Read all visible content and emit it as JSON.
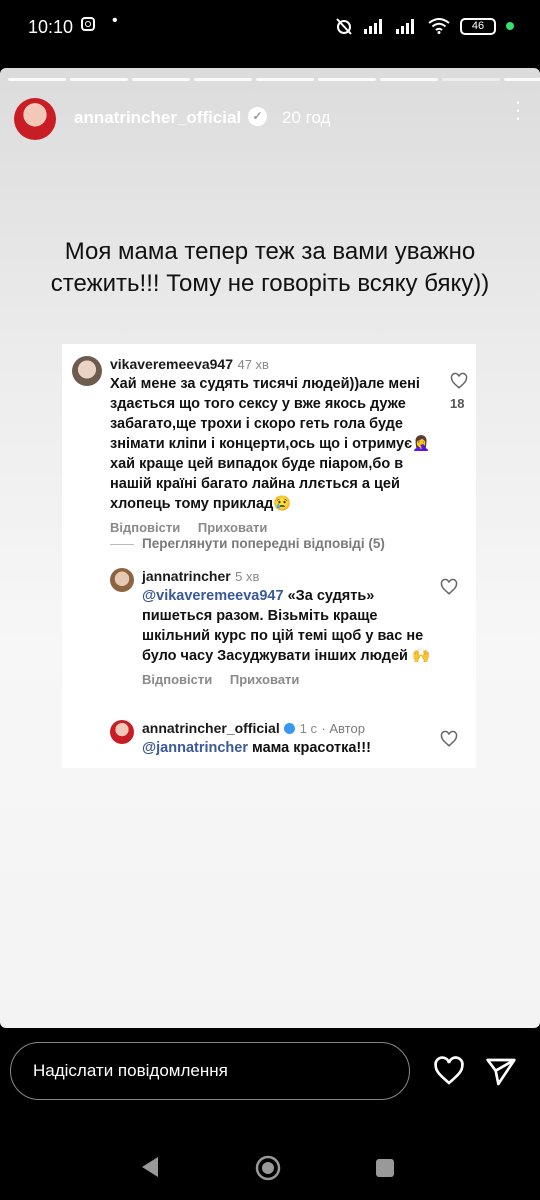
{
  "status_bar": {
    "time": "10:10",
    "battery": "46"
  },
  "story": {
    "username": "annatrincher_official",
    "age": "20 год",
    "caption": "Моя мама тепер теж за вами уважно стежить!!! Тому не говоріть всяку бяку))"
  },
  "comments": [
    {
      "user": "vikaveremeeva947",
      "time": "47 хв",
      "text": "Хай мене за судять тисячі людей))але мені здається що того сексу у вже якось дуже забагато,ще трохи і скоро геть гола буде знімати кліпи і концерти,ось що і отримує🤦‍♀️ хай краще цей випадок буде піаром,бо в нашій країні багато лайна ллється а цей хлопець тому приклад😢",
      "likes": "18",
      "reply_label": "Відповісти",
      "hide_label": "Приховати"
    },
    {
      "view_previous": "Переглянути попередні відповіді (5)"
    },
    {
      "user": "jannatrincher",
      "time": "5 хв",
      "mention": "@vikaveremeeva947",
      "text": " «За судять» пишеться разом. Візьміть краще шкільний курс по цій темі щоб у вас не було часу Засуджувати інших людей 🙌",
      "reply_label": "Відповісти",
      "hide_label": "Приховати"
    },
    {
      "user": "annatrincher_official",
      "time": "1 с",
      "author_label": "Автор",
      "mention": "@jannatrincher",
      "text": " мама красотка!!!"
    }
  ],
  "message_input": {
    "placeholder": "Надіслати повідомлення"
  },
  "colors": {
    "mention": "#3a5998",
    "story_bg": "#ececec"
  }
}
